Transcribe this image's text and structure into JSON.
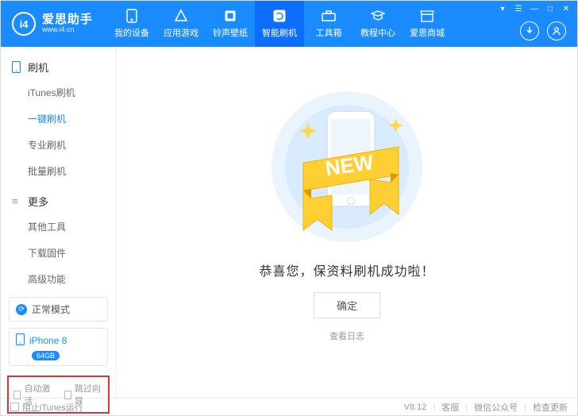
{
  "brand": {
    "name": "爱思助手",
    "url": "www.i4.cn",
    "logo_letters": "i4"
  },
  "win": {
    "menu": "☰",
    "min": "—",
    "max": "□",
    "close": "✕",
    "t": "▾"
  },
  "nav": [
    {
      "label": "我的设备"
    },
    {
      "label": "应用游戏"
    },
    {
      "label": "铃声壁纸"
    },
    {
      "label": "智能刷机",
      "active": true
    },
    {
      "label": "工具箱"
    },
    {
      "label": "教程中心"
    },
    {
      "label": "爱思商城"
    }
  ],
  "sidebar": {
    "sec1_title": "刷机",
    "sec1_items": [
      "iTunes刷机",
      "一键刷机",
      "专业刷机",
      "批量刷机"
    ],
    "sec1_active_index": 1,
    "sec2_title": "更多",
    "sec2_items": [
      "其他工具",
      "下载固件",
      "高级功能"
    ]
  },
  "mode": {
    "label": "正常模式"
  },
  "device": {
    "name": "iPhone 8",
    "storage": "64GB"
  },
  "options": {
    "auto_activate": "自动激活",
    "skip_wizard": "跳过向导"
  },
  "main": {
    "new_label": "NEW",
    "success_text": "恭喜您，保资料刷机成功啦！",
    "ok": "确定",
    "view_log": "查看日志"
  },
  "status": {
    "block_itunes": "阻止iTunes运行",
    "version": "V8.12",
    "support": "客服",
    "wechat": "微信公众号",
    "update": "检查更新"
  }
}
